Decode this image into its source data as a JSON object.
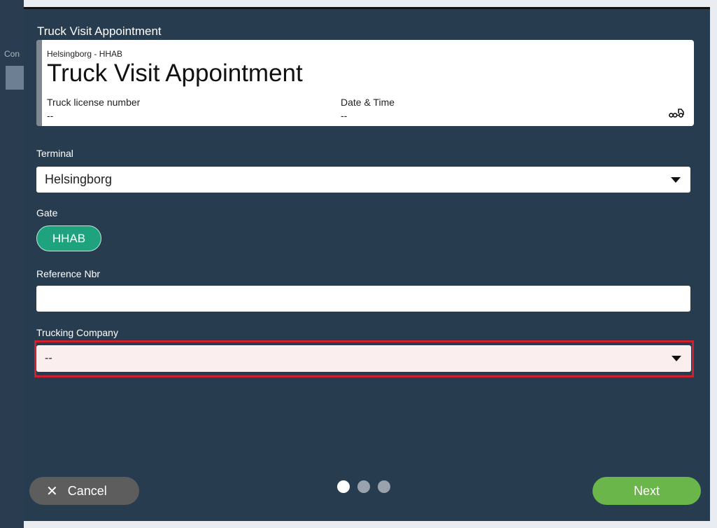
{
  "background": {
    "sidebar_text": "Con"
  },
  "modal": {
    "title": "Truck Visit Appointment",
    "header": {
      "subtitle": "Helsingborg - HHAB",
      "title": "Truck Visit Appointment",
      "truck_license_label": "Truck license number",
      "truck_license_value": "--",
      "datetime_label": "Date & Time",
      "datetime_value": "--",
      "icon": "truck-icon"
    },
    "terminal": {
      "label": "Terminal",
      "value": "Helsingborg"
    },
    "gate": {
      "label": "Gate",
      "chip": "HHAB"
    },
    "reference": {
      "label": "Reference Nbr",
      "value": ""
    },
    "trucking_company": {
      "label": "Trucking Company",
      "value": "--",
      "state": "error"
    },
    "pagination": {
      "total": 3,
      "active": 1
    },
    "buttons": {
      "cancel": "Cancel",
      "next": "Next"
    }
  },
  "colors": {
    "modal_bg": "#283c50",
    "gate_chip": "#1fa37f",
    "next_button": "#6ab64a",
    "cancel_button": "#5d5d5d",
    "error_border": "#d0202f"
  }
}
